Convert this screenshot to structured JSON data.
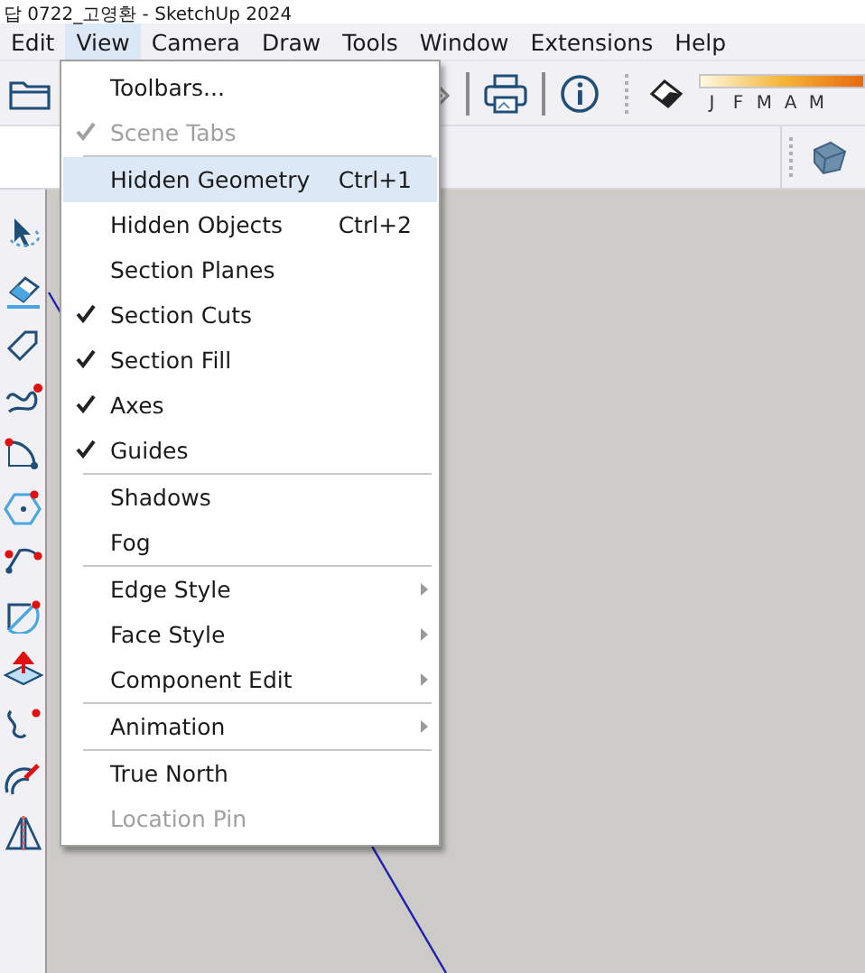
{
  "window": {
    "title": "답 0722_고영환 - SketchUp 2024"
  },
  "menubar": [
    {
      "label": "Edit",
      "selected": false
    },
    {
      "label": "View",
      "selected": true
    },
    {
      "label": "Camera",
      "selected": false
    },
    {
      "label": "Draw",
      "selected": false
    },
    {
      "label": "Tools",
      "selected": false
    },
    {
      "label": "Window",
      "selected": false
    },
    {
      "label": "Extensions",
      "selected": false
    },
    {
      "label": "Help",
      "selected": false
    }
  ],
  "shadow_months": [
    "J",
    "F",
    "M",
    "A",
    "M"
  ],
  "view_menu": [
    [
      {
        "label": "Toolbars...",
        "checked": false,
        "disabled": false,
        "selected": false,
        "submenu": false
      },
      {
        "label": "Scene Tabs",
        "checked": true,
        "disabled": true,
        "selected": false,
        "submenu": false
      }
    ],
    [
      {
        "label": "Hidden Geometry",
        "shortcut": "Ctrl+1",
        "checked": false,
        "disabled": false,
        "selected": true,
        "submenu": false
      },
      {
        "label": "Hidden Objects",
        "shortcut": "Ctrl+2",
        "checked": false,
        "disabled": false,
        "selected": false,
        "submenu": false
      },
      {
        "label": "Section Planes",
        "checked": false,
        "disabled": false,
        "selected": false,
        "submenu": false
      },
      {
        "label": "Section Cuts",
        "checked": true,
        "disabled": false,
        "selected": false,
        "submenu": false
      },
      {
        "label": "Section Fill",
        "checked": true,
        "disabled": false,
        "selected": false,
        "submenu": false
      },
      {
        "label": "Axes",
        "checked": true,
        "disabled": false,
        "selected": false,
        "submenu": false
      },
      {
        "label": "Guides",
        "checked": true,
        "disabled": false,
        "selected": false,
        "submenu": false
      }
    ],
    [
      {
        "label": "Shadows",
        "checked": false,
        "disabled": false,
        "selected": false,
        "submenu": false
      },
      {
        "label": "Fog",
        "checked": false,
        "disabled": false,
        "selected": false,
        "submenu": false
      }
    ],
    [
      {
        "label": "Edge Style",
        "checked": false,
        "disabled": false,
        "selected": false,
        "submenu": true
      },
      {
        "label": "Face Style",
        "checked": false,
        "disabled": false,
        "selected": false,
        "submenu": true
      },
      {
        "label": "Component Edit",
        "checked": false,
        "disabled": false,
        "selected": false,
        "submenu": true
      }
    ],
    [
      {
        "label": "Animation",
        "checked": false,
        "disabled": false,
        "selected": false,
        "submenu": true
      }
    ],
    [
      {
        "label": "True North",
        "checked": false,
        "disabled": false,
        "selected": false,
        "submenu": false
      },
      {
        "label": "Location Pin",
        "checked": false,
        "disabled": true,
        "selected": false,
        "submenu": false
      }
    ]
  ]
}
